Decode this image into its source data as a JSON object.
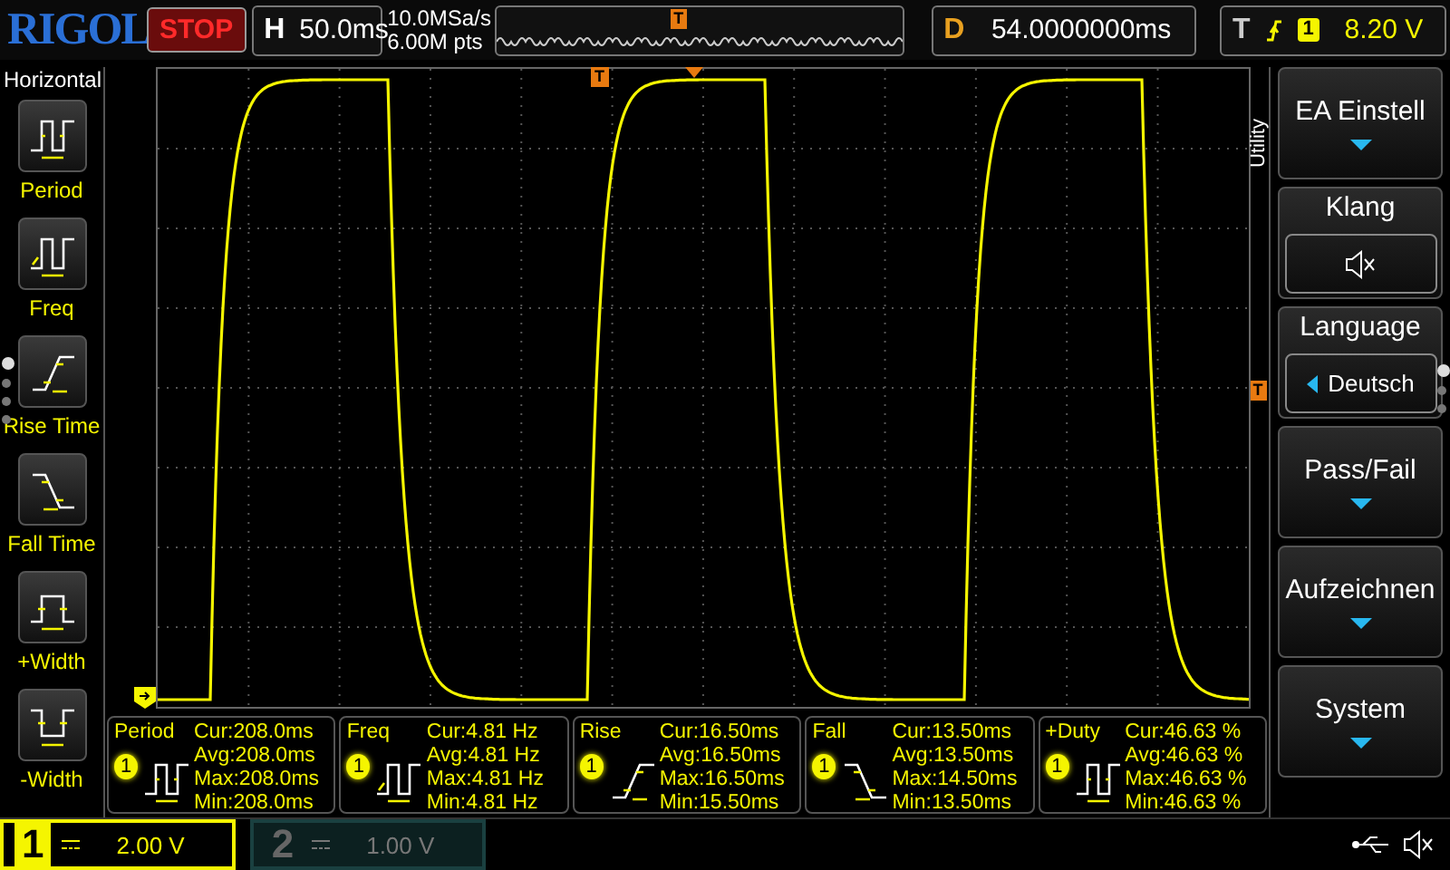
{
  "brand": "RIGOL",
  "run_state": "STOP",
  "timebase": {
    "label": "H",
    "value": "50.0ms"
  },
  "acquisition": {
    "sample_rate": "10.0MSa/s",
    "memory_depth": "6.00M pts"
  },
  "memory_overview": {
    "trigger_marker": "T"
  },
  "delay": {
    "label": "D",
    "value": "54.0000000ms"
  },
  "trigger": {
    "label": "T",
    "channel": "1",
    "level": "8.20 V"
  },
  "display": {
    "trigger_marker": "T",
    "level_marker": "T"
  },
  "left_menu": {
    "title": "Horizontal",
    "items": [
      {
        "label": "Period",
        "kind": "period"
      },
      {
        "label": "Freq",
        "kind": "freq"
      },
      {
        "label": "Rise Time",
        "kind": "rise"
      },
      {
        "label": "Fall Time",
        "kind": "fall"
      },
      {
        "label": "+Width",
        "kind": "pwidth"
      },
      {
        "label": "-Width",
        "kind": "nwidth"
      }
    ],
    "page_dots": [
      {
        "selected": true
      },
      {
        "selected": false
      },
      {
        "selected": false
      },
      {
        "selected": false
      }
    ]
  },
  "right_menu": {
    "title": "Utility",
    "items": [
      {
        "label": "EA Einstell",
        "kind": "submenu"
      },
      {
        "label": "Klang",
        "kind": "sound"
      },
      {
        "label": "Language",
        "kind": "select",
        "value": "Deutsch"
      },
      {
        "label": "Pass/Fail",
        "kind": "submenu"
      },
      {
        "label": "Aufzeichnen",
        "kind": "submenu"
      },
      {
        "label": "System",
        "kind": "submenu"
      }
    ],
    "page_dots": [
      {
        "selected": true
      },
      {
        "selected": false
      },
      {
        "selected": false
      }
    ]
  },
  "measurements": [
    {
      "name": "Period",
      "channel": "1",
      "kind": "period",
      "lines": [
        "Cur:208.0ms",
        "Avg:208.0ms",
        "Max:208.0ms",
        "Min:208.0ms"
      ]
    },
    {
      "name": "Freq",
      "channel": "1",
      "kind": "freq",
      "lines": [
        "Cur:4.81 Hz",
        "Avg:4.81 Hz",
        "Max:4.81 Hz",
        "Min:4.81 Hz"
      ]
    },
    {
      "name": "Rise",
      "channel": "1",
      "kind": "rise",
      "lines": [
        "Cur:16.50ms",
        "Avg:16.50ms",
        "Max:16.50ms",
        "Min:15.50ms"
      ]
    },
    {
      "name": "Fall",
      "channel": "1",
      "kind": "fall",
      "lines": [
        "Cur:13.50ms",
        "Avg:13.50ms",
        "Max:14.50ms",
        "Min:13.50ms"
      ]
    },
    {
      "name": "+Duty",
      "channel": "1",
      "kind": "duty",
      "lines": [
        "Cur:46.63 %",
        "Avg:46.63 %",
        "Max:46.63 %",
        "Min:46.63 %"
      ]
    }
  ],
  "channels": [
    {
      "number": "1",
      "scale": "2.00 V",
      "selected": true
    },
    {
      "number": "2",
      "scale": "1.00 V",
      "selected": false
    }
  ]
}
